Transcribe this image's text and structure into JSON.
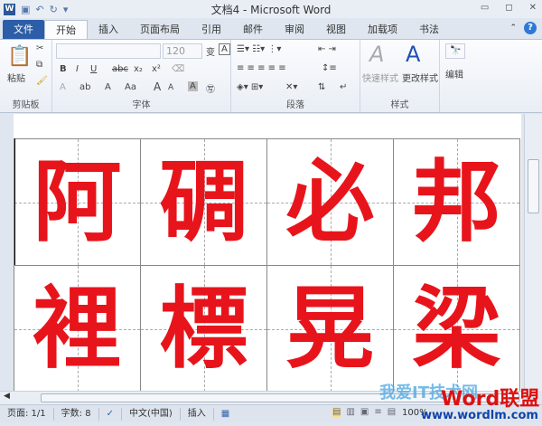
{
  "window": {
    "title": "文档4 - Microsoft Word",
    "app_icon": "W"
  },
  "tabs": [
    "文件",
    "开始",
    "插入",
    "页面布局",
    "引用",
    "邮件",
    "审阅",
    "视图",
    "加载项",
    "书法"
  ],
  "ribbon": {
    "clipboard": {
      "label": "剪贴板",
      "paste": "粘贴"
    },
    "font": {
      "label": "字体",
      "font_name": "",
      "font_size": "120",
      "bold": "B",
      "italic": "I",
      "underline": "U",
      "strike": "abc",
      "sub": "x₂",
      "sup": "x²",
      "grow": "A",
      "shrink": "A",
      "case": "Aa",
      "color": "A"
    },
    "paragraph": {
      "label": "段落"
    },
    "styles": {
      "label": "样式",
      "quick": "快速样式",
      "change": "更改样式"
    },
    "editing": {
      "label": "编辑"
    }
  },
  "document": {
    "rows": [
      [
        "阿",
        "碉",
        "必",
        "邦"
      ],
      [
        "裡",
        "標",
        "晃",
        "梁"
      ]
    ],
    "text_color": "#e8141b"
  },
  "status": {
    "page": "页面: 1/1",
    "words": "字数: 8",
    "language": "中文(中国)",
    "mode": "插入",
    "zoom": "100%"
  },
  "watermark": {
    "line1": "我爱IT技术网",
    "brand": "Word联盟",
    "url": "www.wordlm.com"
  }
}
